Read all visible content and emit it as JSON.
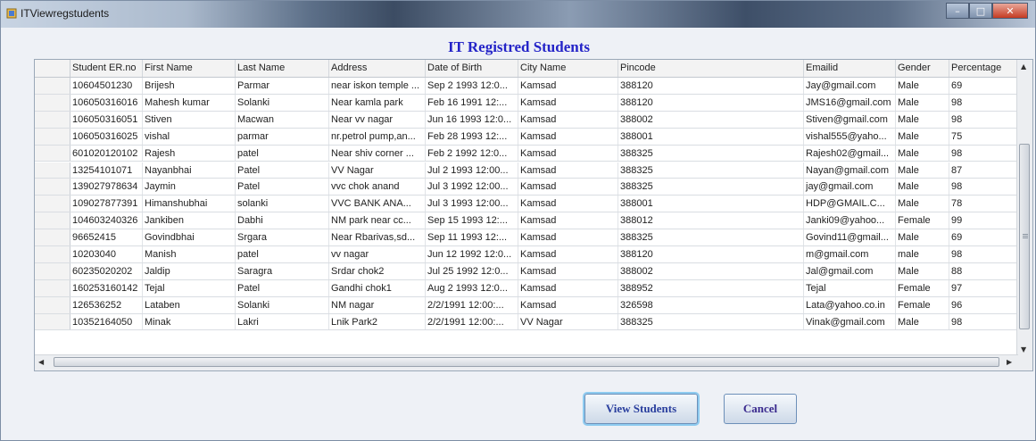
{
  "window": {
    "title": "ITViewregstudents"
  },
  "heading": "IT Registred Students",
  "grid": {
    "columns": [
      "Student ER.no",
      "First Name",
      "Last Name",
      "Address",
      "Date of Birth",
      "City Name",
      "Pincode",
      "Emailid",
      "Gender",
      "Percentage"
    ],
    "rows": [
      [
        "10604501230",
        "Brijesh",
        "Parmar",
        "near iskon temple ...",
        "Sep  2 1993 12:0...",
        "Kamsad",
        "388120",
        "Jay@gmail.com",
        "Male",
        "69"
      ],
      [
        "106050316016",
        "Mahesh kumar",
        "Solanki",
        "Near kamla park",
        "Feb 16 1991 12:...",
        "Kamsad",
        "388120",
        "JMS16@gmail.com",
        "Male",
        "98"
      ],
      [
        "106050316051",
        "Stiven",
        "Macwan",
        "Near vv nagar",
        "Jun 16 1993 12:0...",
        "Kamsad",
        "388002",
        "Stiven@gmail.com",
        "Male",
        "98"
      ],
      [
        "106050316025",
        "vishal",
        "parmar",
        "nr.petrol pump,an...",
        "Feb 28 1993 12:...",
        "Kamsad",
        "388001",
        "vishal555@yaho...",
        "Male",
        "75"
      ],
      [
        "601020120102",
        "Rajesh",
        "patel",
        "Near shiv corner ...",
        "Feb  2 1992 12:0...",
        "Kamsad",
        "388325",
        "Rajesh02@gmail...",
        "Male",
        "98"
      ],
      [
        "13254101071",
        "Nayanbhai",
        "Patel",
        "VV Nagar",
        "Jul  2 1993 12:00...",
        "Kamsad",
        "388325",
        "Nayan@gmail.com",
        "Male",
        "87"
      ],
      [
        "139027978634",
        "Jaymin",
        "Patel",
        "vvc chok anand",
        "Jul  3 1992 12:00...",
        "Kamsad",
        "388325",
        "jay@gmail.com",
        "Male",
        "98"
      ],
      [
        "109027877391",
        "Himanshubhai",
        "solanki",
        "VVC BANK ANA...",
        "Jul  3 1993 12:00...",
        "Kamsad",
        "388001",
        "HDP@GMAIL.C...",
        "Male",
        "78"
      ],
      [
        "104603240326",
        "Jankiben",
        "Dabhi",
        "NM park near cc...",
        "Sep 15 1993 12:...",
        "Kamsad",
        "388012",
        "Janki09@yahoo...",
        "Female",
        "99"
      ],
      [
        "96652415",
        "Govindbhai",
        "Srgara",
        "Near Rbarivas,sd...",
        "Sep 11 1993 12:...",
        "Kamsad",
        "388325",
        "Govind11@gmail...",
        "Male",
        "69"
      ],
      [
        "10203040",
        "Manish",
        "patel",
        "vv nagar",
        "Jun 12 1992 12:0...",
        "Kamsad",
        "388120",
        "m@gmail.com",
        "male",
        "98"
      ],
      [
        "60235020202",
        "Jaldip",
        "Saragra",
        "Srdar chok2",
        "Jul 25 1992 12:0...",
        "Kamsad",
        "388002",
        "Jal@gmail.com",
        "Male",
        "88"
      ],
      [
        "160253160142",
        "Tejal",
        "Patel",
        "Gandhi chok1",
        "Aug  2 1993 12:0...",
        "Kamsad",
        "388952",
        "Tejal",
        "Female",
        "97"
      ],
      [
        "126536252",
        "Lataben",
        "Solanki",
        "NM nagar",
        "2/2/1991 12:00:...",
        "Kamsad",
        "326598",
        "Lata@yahoo.co.in",
        "Female",
        "96"
      ],
      [
        "10352164050",
        "Minak",
        "Lakri",
        "Lnik Park2",
        "2/2/1991 12:00:...",
        "VV Nagar",
        "388325",
        "Vinak@gmail.com",
        "Male",
        "98"
      ]
    ]
  },
  "buttons": {
    "view": "View Students",
    "cancel": "Cancel"
  },
  "icons": {
    "app": "app-icon"
  },
  "colors": {
    "heading": "#2424c8",
    "button_text": "#2a3f9e"
  }
}
